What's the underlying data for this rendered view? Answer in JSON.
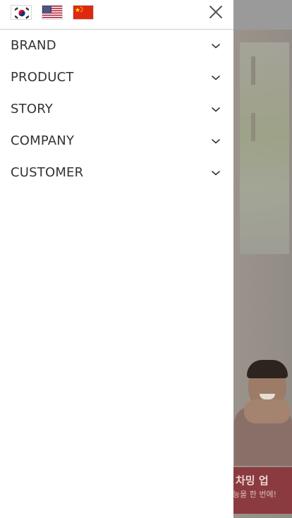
{
  "languages": [
    {
      "code": "ko",
      "name": "Korean"
    },
    {
      "code": "en",
      "name": "English"
    },
    {
      "code": "zh",
      "name": "Chinese"
    }
  ],
  "menu": {
    "items": [
      {
        "label": "BRAND"
      },
      {
        "label": "PRODUCT"
      },
      {
        "label": "STORY"
      },
      {
        "label": "COMPANY"
      },
      {
        "label": "CUSTOMER"
      }
    ]
  },
  "background": {
    "banner_title": "차밍 업",
    "banner_sub": "능을 한 번에!"
  },
  "colors": {
    "drawer_bg": "#ffffff",
    "menu_text": "#333333",
    "banner": "#8b3b3f"
  },
  "icons": {
    "close": "close-icon",
    "expand": "chevron-down-icon"
  }
}
